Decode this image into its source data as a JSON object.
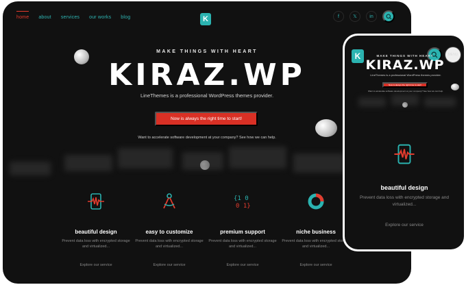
{
  "desktop": {
    "nav": [
      {
        "label": "home",
        "active": true
      },
      {
        "label": "about",
        "active": false
      },
      {
        "label": "services",
        "active": false
      },
      {
        "label": "our works",
        "active": false
      },
      {
        "label": "blog",
        "active": false
      }
    ],
    "logo_letter": "K",
    "social": {
      "facebook_glyph": "f",
      "x_glyph": "𝕏",
      "linkedin_glyph": "in"
    },
    "hero": {
      "kicker": "MAKE THINGS WITH HEART",
      "title": "KIRAZ.WP",
      "subtitle": "LineThemes is a professional WordPress themes provider.",
      "cta": "Now is always the right time to start!",
      "note": "Want to accelerate software development at your company? See how we can help."
    },
    "features": [
      {
        "title": "beautiful design",
        "desc": "Prevent data loss with encrypted storage and virtualized...",
        "link": "Explore our service",
        "icon": "phone-pulse-icon"
      },
      {
        "title": "easy to customize",
        "desc": "Prevent data loss with encrypted storage and virtualized...",
        "link": "Explore our service",
        "icon": "compass-tool-icon"
      },
      {
        "title": "premium support",
        "desc": "Prevent data loss with encrypted storage and virtualized...",
        "link": "Explore our service",
        "icon": "binary-code-icon"
      },
      {
        "title": "niche business",
        "desc": "Prevent data loss with encrypted storage and virtualized...",
        "link": "Explore our service",
        "icon": "donut-chart-icon"
      }
    ],
    "binary_icon_text": "{1 0\n0 1}"
  },
  "mobile": {
    "logo_letter": "K",
    "menu_label": "MENU",
    "kicker": "MAKE THINGS WITH HEART",
    "title": "KIRAZ.WP",
    "subtitle": "LineThemes is a professional WordPress themes provider.",
    "cta": "Now is always the right time to start!",
    "note": "Want to accelerate software development at your company? See how we can help.",
    "feature": {
      "title": "beautiful design",
      "desc": "Prevent data loss with encrypted storage and virtualized...",
      "link": "Explore our service",
      "icon": "phone-pulse-icon"
    }
  },
  "colors": {
    "background": "#111111",
    "accent_teal": "#2bb3b0",
    "accent_red": "#d93025"
  }
}
